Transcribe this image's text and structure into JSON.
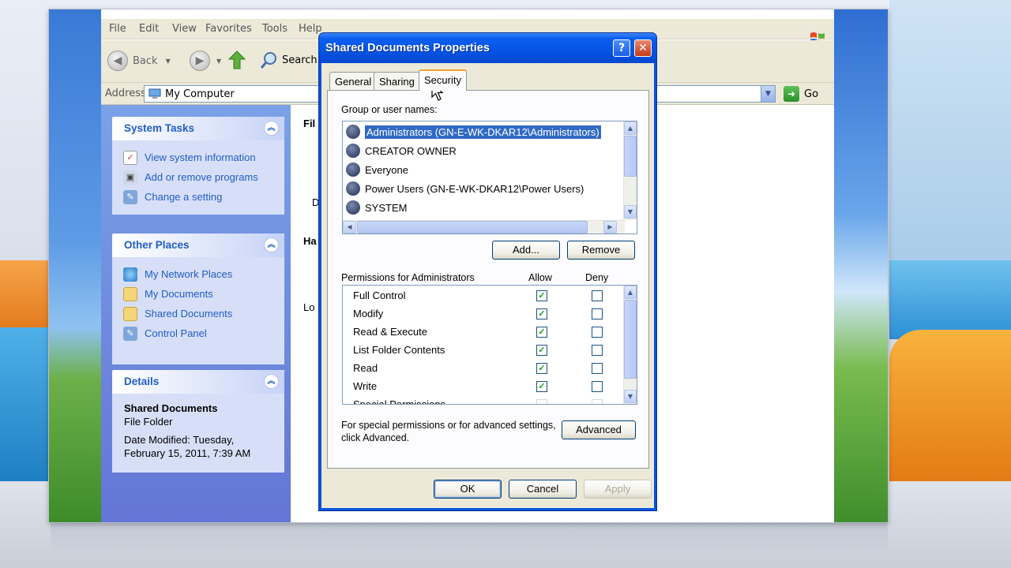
{
  "explorer": {
    "menu": [
      "File",
      "Edit",
      "View",
      "Favorites",
      "Tools",
      "Help"
    ],
    "toolbar": {
      "back": "Back",
      "search": "Search"
    },
    "address": {
      "label": "Address",
      "value": "My Computer",
      "go": "Go"
    },
    "system_tasks": {
      "title": "System Tasks",
      "links": [
        "View system information",
        "Add or remove programs",
        "Change a setting"
      ]
    },
    "other_places": {
      "title": "Other Places",
      "links": [
        "My Network Places",
        "My Documents",
        "Shared Documents",
        "Control Panel"
      ]
    },
    "details": {
      "title": "Details",
      "name": "Shared Documents",
      "type": "File Folder",
      "modified_1": "Date Modified: Tuesday,",
      "modified_2": "February 15, 2011, 7:39 AM"
    },
    "partial_text": [
      "Fil",
      "D",
      "Ha",
      "Lo"
    ]
  },
  "dialog": {
    "title": "Shared Documents Properties",
    "help": "?",
    "close": "✕",
    "tabs": [
      "General",
      "Sharing",
      "Security"
    ],
    "active_tab": "Security",
    "group_label": "Group or user names:",
    "users": [
      "Administrators (GN-E-WK-DKAR12\\Administrators)",
      "CREATOR OWNER",
      "Everyone",
      "Power Users (GN-E-WK-DKAR12\\Power Users)",
      "SYSTEM"
    ],
    "add_button": "Add...",
    "remove_button": "Remove",
    "permissions_label": "Permissions for Administrators",
    "allow_header": "Allow",
    "deny_header": "Deny",
    "permissions": [
      {
        "name": "Full Control",
        "allow": true,
        "deny": false
      },
      {
        "name": "Modify",
        "allow": true,
        "deny": false
      },
      {
        "name": "Read & Execute",
        "allow": true,
        "deny": false
      },
      {
        "name": "List Folder Contents",
        "allow": true,
        "deny": false
      },
      {
        "name": "Read",
        "allow": true,
        "deny": false
      },
      {
        "name": "Write",
        "allow": true,
        "deny": false
      },
      {
        "name": "Special Permissions",
        "allow": false,
        "deny": false
      }
    ],
    "advanced_text_1": "For special permissions or for advanced settings,",
    "advanced_text_2": "click Advanced.",
    "advanced_button": "Advanced",
    "ok": "OK",
    "cancel": "Cancel",
    "apply": "Apply"
  },
  "colors": {
    "xp_blue": "#0a5ef0",
    "selection": "#316ac5",
    "link": "#215dc6",
    "tab_highlight": "#f5a12a"
  }
}
